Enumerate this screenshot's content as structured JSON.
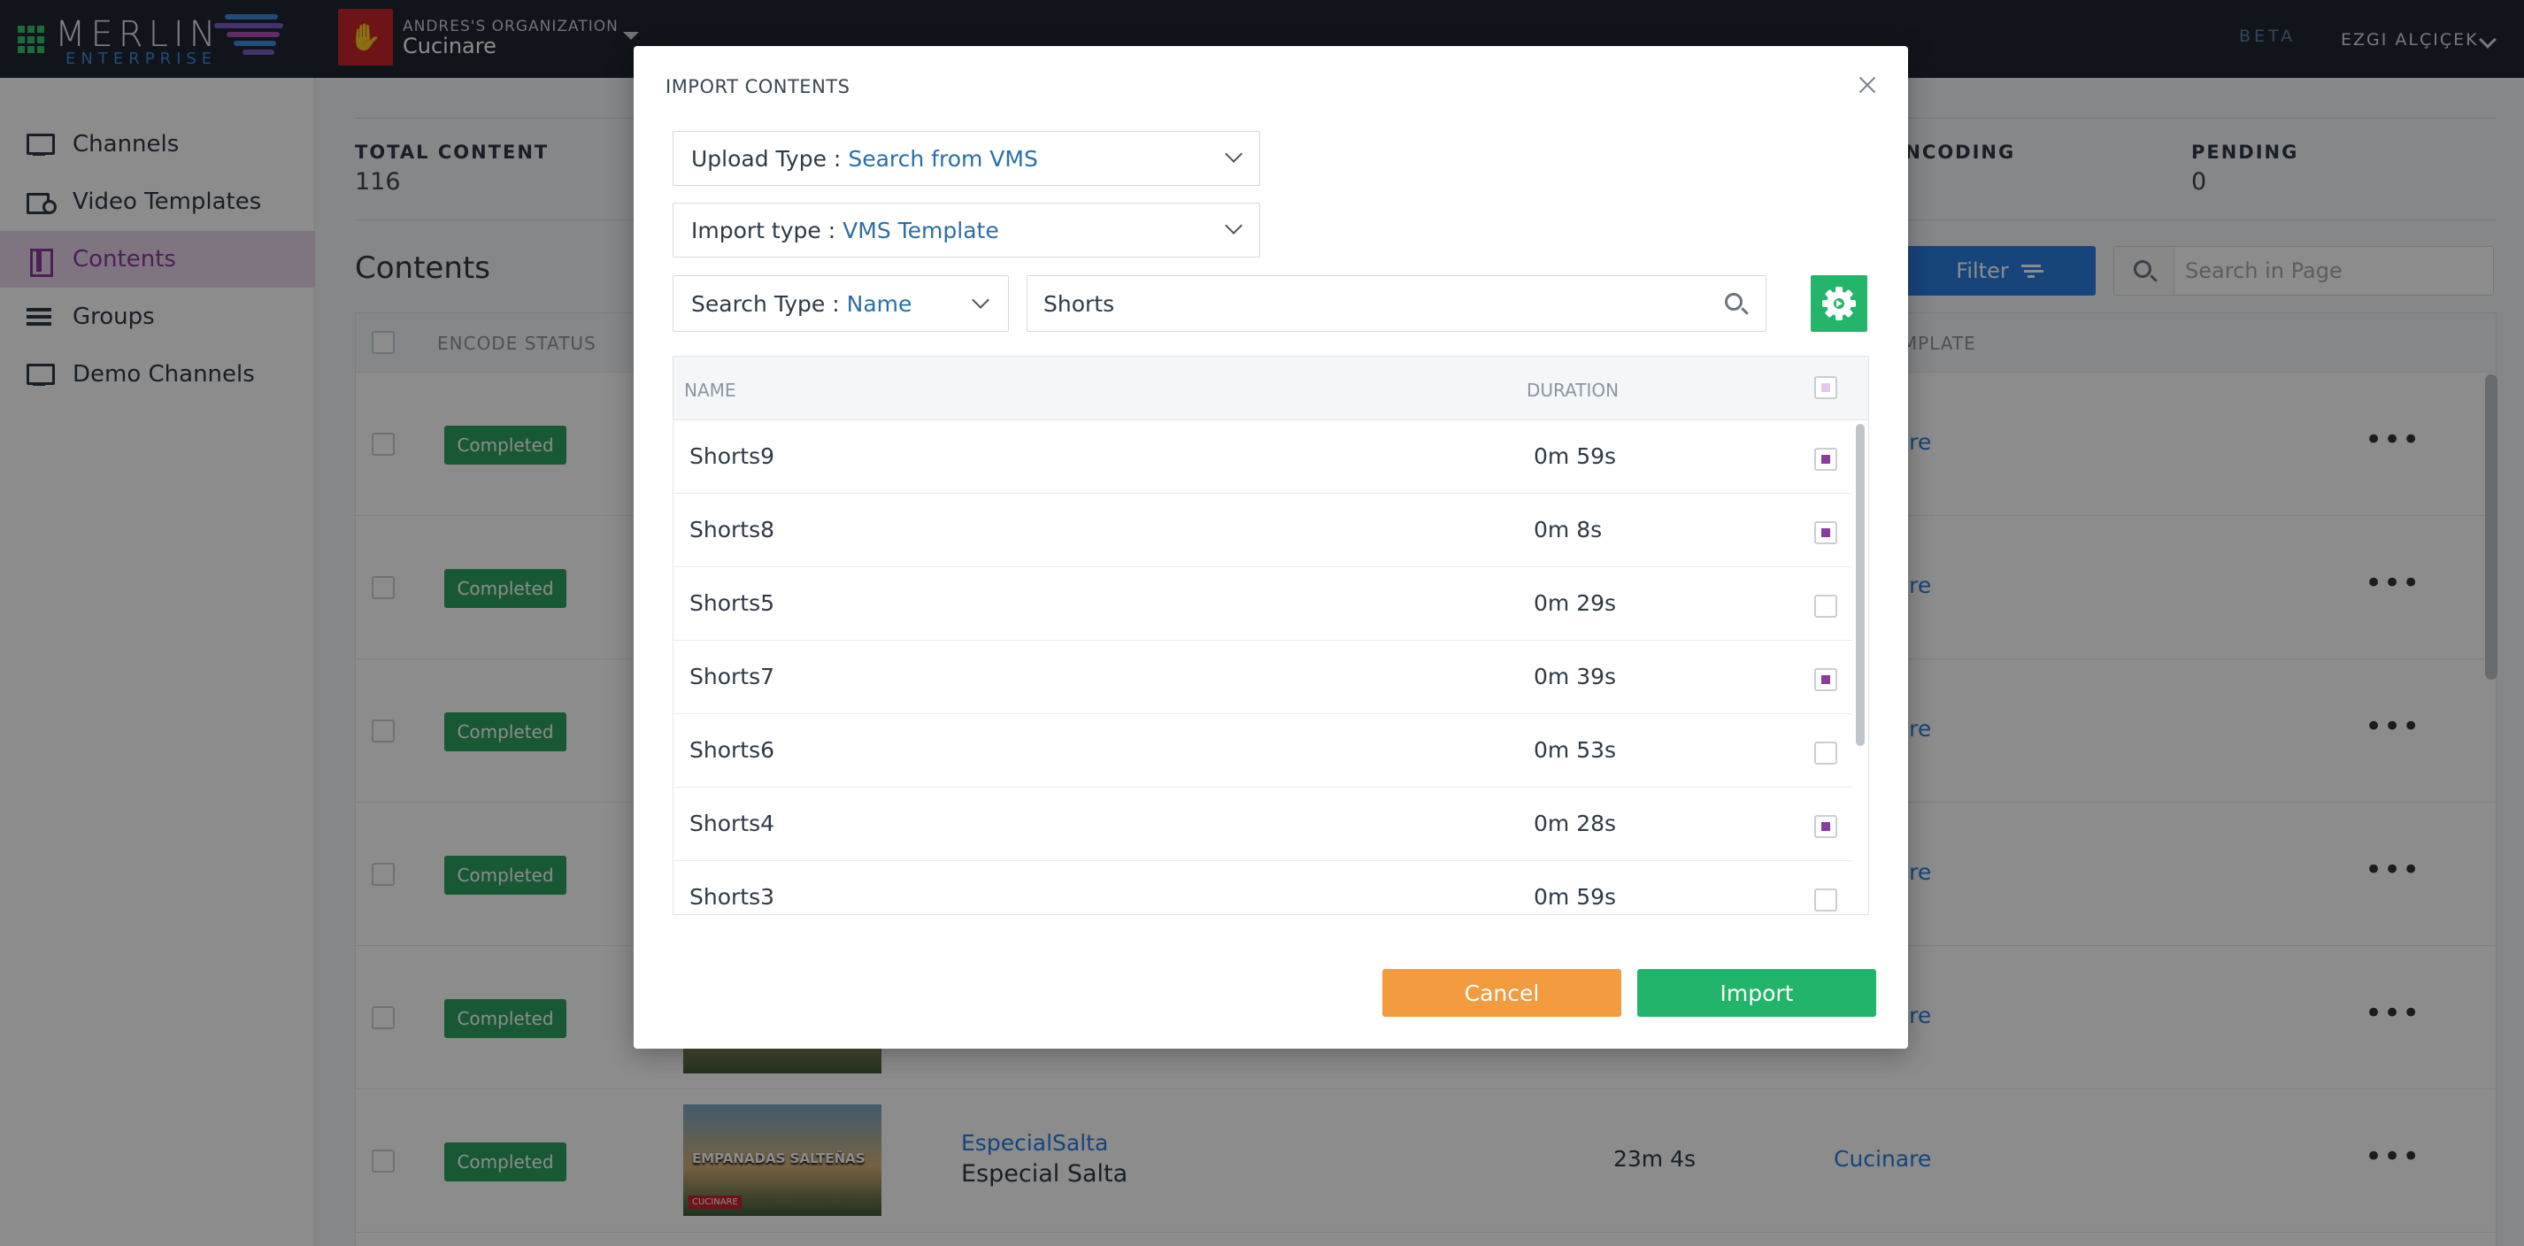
{
  "topbar": {
    "logo_text": "MERLIN",
    "logo_sub": "ENTERPRISE",
    "org_label": "ANDRES'S ORGANIZATION",
    "org_name": "Cucinare",
    "beta": "BETA",
    "user_name": "EZGI ALÇIÇEK",
    "colors": {
      "bg": "#1f2630",
      "org_avatar": "#c8232c",
      "apps": "#39c16c"
    }
  },
  "sidebar": {
    "items": [
      {
        "label": "Channels",
        "icon": "monitor-icon",
        "active": false
      },
      {
        "label": "Video Templates",
        "icon": "video-settings-icon",
        "active": false
      },
      {
        "label": "Contents",
        "icon": "film-icon",
        "active": true
      },
      {
        "label": "Groups",
        "icon": "groups-icon",
        "active": false
      },
      {
        "label": "Demo Channels",
        "icon": "monitor-icon",
        "active": false
      }
    ]
  },
  "stats": [
    {
      "label": "TOTAL CONTENT",
      "value": "116"
    },
    {
      "label": "ENCODING",
      "value": ""
    },
    {
      "label": "PENDING",
      "value": "0"
    }
  ],
  "contents": {
    "title": "Contents",
    "filter_label": "Filter",
    "search_placeholder": "Search in Page",
    "columns": {
      "encode_status": "ENCODE STATUS",
      "template": "TEMPLATE"
    },
    "rows": [
      {
        "status": "Completed",
        "template": "Cucinare",
        "more": "•••"
      },
      {
        "status": "Completed",
        "template": "Cucinare",
        "more": "•••"
      },
      {
        "status": "Completed",
        "template": "Cucinare",
        "more": "•••"
      },
      {
        "status": "Completed",
        "template": "Cucinare",
        "more": "•••"
      },
      {
        "status": "Completed",
        "template": "Cucinare",
        "more": "•••"
      },
      {
        "status": "Completed",
        "template": "Cucinare",
        "more": "•••",
        "thumb_text": "EMPANADAS SALTEÑAS",
        "thumb_brand": "CUCINARE",
        "link": "EspecialSalta",
        "name": "Especial Salta",
        "duration": "23m 4s"
      }
    ]
  },
  "modal": {
    "title": "IMPORT CONTENTS",
    "upload_type": {
      "label": "Upload Type :",
      "value": "Search from VMS"
    },
    "import_type": {
      "label": "Import type :",
      "value": "VMS Template"
    },
    "search_type": {
      "label": "Search Type :",
      "value": "Name"
    },
    "search_value": "Shorts",
    "columns": {
      "name": "NAME",
      "duration": "DURATION"
    },
    "results": [
      {
        "name": "Shorts9",
        "duration": "0m 59s",
        "checked": true
      },
      {
        "name": "Shorts8",
        "duration": "0m 8s",
        "checked": true
      },
      {
        "name": "Shorts5",
        "duration": "0m 29s",
        "checked": false
      },
      {
        "name": "Shorts7",
        "duration": "0m 39s",
        "checked": true
      },
      {
        "name": "Shorts6",
        "duration": "0m 53s",
        "checked": false
      },
      {
        "name": "Shorts4",
        "duration": "0m 28s",
        "checked": true
      },
      {
        "name": "Shorts3",
        "duration": "0m 59s",
        "checked": false
      }
    ],
    "cancel_label": "Cancel",
    "import_label": "Import",
    "colors": {
      "cancel": "#f39b3f",
      "import": "#21b46a",
      "check": "#8a3b9f"
    }
  }
}
